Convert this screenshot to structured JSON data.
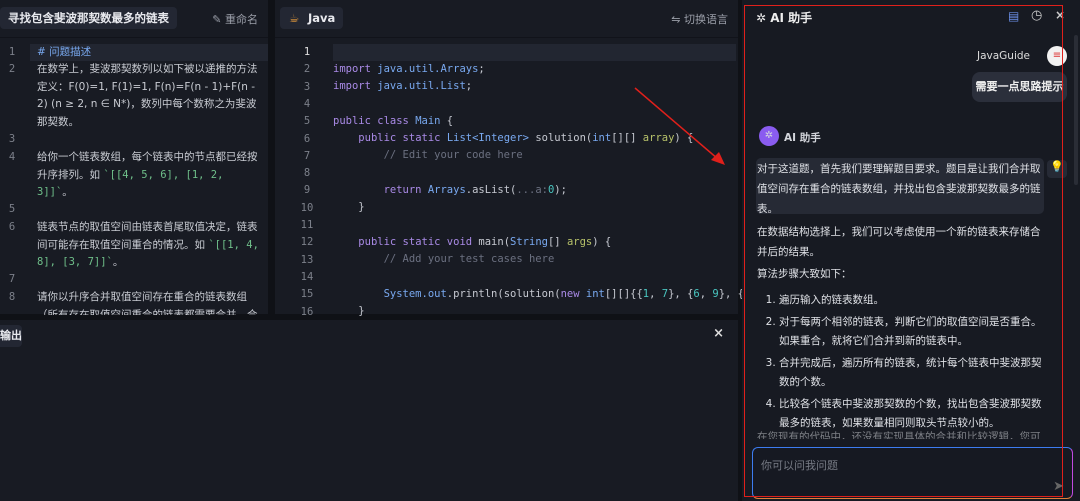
{
  "problem": {
    "title": "寻找包含斐波那契数最多的链表",
    "rename": "重命名",
    "lines": [
      {
        "n": "1",
        "t": "# 问题描述"
      },
      {
        "n": "2",
        "t": "在数学上，斐波那契数列以如下被以递推的方法定义：F(0)=1, F(1)=1, F(n)=F(n - 1)+F(n - 2) (n ≥ 2, n ∈ N*)，数列中每个数称之为斐波那契数。"
      },
      {
        "n": "3",
        "t": ""
      },
      {
        "n": "4",
        "t": "给你一个链表数组，每个链表中的节点都已经按升序排列。如 ",
        "code": "`[[4, 5, 6], [1, 2, 3]]`",
        "end": "。"
      },
      {
        "n": "5",
        "t": ""
      },
      {
        "n": "6",
        "t": "链表节点的取值空间由链表首尾取值决定，链表间可能存在取值空间重合的情况。如 ",
        "code": "`[[1, 4, 8], [3, 7]]`",
        "end": "。"
      },
      {
        "n": "7",
        "t": ""
      },
      {
        "n": "8",
        "t": "请你以升序合并取值空间存在重合的链表数组（所有存在取值空间重合的链表都需要合并，合"
      }
    ]
  },
  "editor": {
    "language": "Java",
    "switch_language": "切换语言",
    "line_numbers": [
      "1",
      "2",
      "3",
      "4",
      "5",
      "6",
      "7",
      "8",
      "9",
      "10",
      "11",
      "12",
      "13",
      "14",
      "15",
      "16"
    ]
  },
  "output": {
    "tab": "输出",
    "close": "×"
  },
  "ai": {
    "title": "AI 助手",
    "user_name": "JavaGuide",
    "user_message": "需要一点思路提示",
    "bot_name": "AI 助手",
    "p1": "对于这道题，首先我们要理解题目要求。题目是让我们合并取值空间存在重合的链表数组，并找出包含斐波那契数最多的链表。",
    "p2": "在数据结构选择上，我们可以考虑使用一个新的链表来存储合并后的结果。",
    "p3": "算法步骤大致如下：",
    "steps": [
      "遍历输入的链表数组。",
      "对于每两个相邻的链表，判断它们的取值空间是否重合。如果重合，就将它们合并到新的链表中。",
      "合并完成后，遍历所有的链表，统计每个链表中斐波那契数的个数。",
      "比较各个链表中斐波那契数的个数，找出包含斐波那契数最多的链表，如果数量相同则取头节点较小的。"
    ],
    "p4": "在您现有的代码中，还没有实现具体的合并和比较逻辑，您可",
    "input_placeholder": "你可以问我问题"
  },
  "colors": {
    "annotation": "#e0201b",
    "accent": "#8a5cf0"
  }
}
